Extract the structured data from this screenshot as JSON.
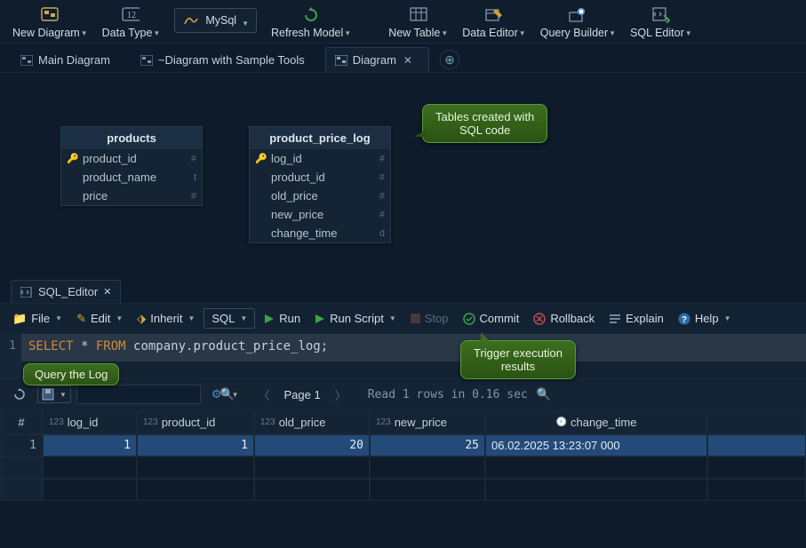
{
  "toolbar": {
    "new_diagram": "New Diagram",
    "data_type": "Data Type",
    "db_combo": "MySql",
    "refresh": "Refresh Model",
    "new_table": "New Table",
    "data_editor": "Data Editor",
    "query_builder": "Query Builder",
    "sql_editor": "SQL Editor"
  },
  "diagram_tabs": {
    "t0": "Main Diagram",
    "t1": "~Diagram with Sample Tools",
    "t2": "Diagram"
  },
  "callouts": {
    "tables_created": "Tables created with\nSQL code",
    "query_log": "Query the Log",
    "trigger_results": "Trigger execution\nresults"
  },
  "entities": {
    "products": {
      "title": "products",
      "cols": [
        {
          "name": "product_id",
          "key": true,
          "t": "#"
        },
        {
          "name": "product_name",
          "key": false,
          "t": "t"
        },
        {
          "name": "price",
          "key": false,
          "t": "#"
        }
      ]
    },
    "ppl": {
      "title": "product_price_log",
      "cols": [
        {
          "name": "log_id",
          "key": true,
          "t": "#"
        },
        {
          "name": "product_id",
          "key": false,
          "t": "#"
        },
        {
          "name": "old_price",
          "key": false,
          "t": "#"
        },
        {
          "name": "new_price",
          "key": false,
          "t": "#"
        },
        {
          "name": "change_time",
          "key": false,
          "t": "d"
        }
      ]
    }
  },
  "sql_tab": "SQL_Editor",
  "sql_actions": {
    "file": "File",
    "edit": "Edit",
    "inherit": "Inherit",
    "sql": "SQL",
    "run": "Run",
    "run_script": "Run Script",
    "stop": "Stop",
    "commit": "Commit",
    "rollback": "Rollback",
    "explain": "Explain",
    "help": "Help"
  },
  "sql_code": {
    "line_no": "1",
    "kw1": "SELECT",
    "star": " * ",
    "kw2": "FROM",
    "rest": " company.product_price_log;"
  },
  "results": {
    "page_label": "Page 1",
    "status": "Read 1 rows in 0.16 sec",
    "headers": {
      "h0": "#",
      "h1": "log_id",
      "h2": "product_id",
      "h3": "old_price",
      "h4": "new_price",
      "h5": "change_time"
    },
    "row1": {
      "idx": "1",
      "log_id": "1",
      "product_id": "1",
      "old_price": "20",
      "new_price": "25",
      "change_time": "06.02.2025 13:23:07 000"
    }
  }
}
